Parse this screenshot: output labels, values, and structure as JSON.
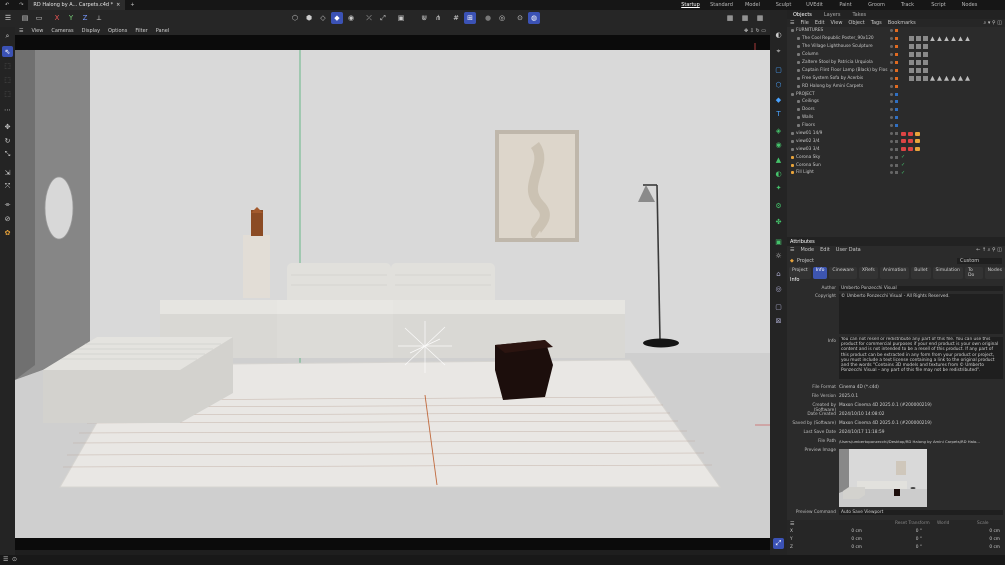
{
  "window": {
    "tab_title": "RD Halong by A... Carpets.c4d *",
    "layouts": [
      "Startup",
      "Standard",
      "Model",
      "Sculpt",
      "UVEdit",
      "Paint",
      "Groom",
      "Track",
      "Script",
      "Nodes"
    ],
    "active_layout": "Startup"
  },
  "viewport_menu": [
    "View",
    "Cameras",
    "Display",
    "Options",
    "Filter",
    "Panel"
  ],
  "object_manager": {
    "tabs": [
      "Objects",
      "Layers",
      "Takes"
    ],
    "active_tab": "Objects",
    "menu": [
      "File",
      "Edit",
      "View",
      "Object",
      "Tags",
      "Bookmarks"
    ],
    "items": [
      {
        "name": "FURNITURES",
        "color": "#e06a20"
      },
      {
        "name": "The Cool Republic Poster_90x120",
        "color": "#e06a20"
      },
      {
        "name": "The Village Lighthouse Sculpture",
        "color": "#e06a20"
      },
      {
        "name": "Column",
        "color": "#e06a20"
      },
      {
        "name": "Zaltere Stool by Patricia Urquiola",
        "color": "#e06a20"
      },
      {
        "name": "Captain Flint Floor Lamp (Black) by Flos",
        "color": "#e06a20"
      },
      {
        "name": "Free System Sofa by Acerbis",
        "color": "#e06a20"
      },
      {
        "name": "RD Halong by Amini Carpets",
        "color": "#e06a20"
      },
      {
        "name": "PROJECT",
        "color": "#2f6fc2"
      },
      {
        "name": "Ceilings",
        "color": "#2f6fc2"
      },
      {
        "name": "Doors",
        "color": "#2f6fc2"
      },
      {
        "name": "Walls",
        "color": "#2f6fc2"
      },
      {
        "name": "Floors",
        "color": "#2f6fc2"
      },
      {
        "name": "view01 14/9",
        "color": ""
      },
      {
        "name": "view02 3/4",
        "color": ""
      },
      {
        "name": "view03 3/4",
        "color": ""
      },
      {
        "name": "Corona Sky",
        "color": ""
      },
      {
        "name": "Corona Sun",
        "color": ""
      },
      {
        "name": "Fill Light",
        "color": ""
      }
    ]
  },
  "attributes": {
    "title": "Attributes",
    "menu": [
      "Mode",
      "Edit",
      "User Data"
    ],
    "object_label": "Project",
    "mode_value": "Custom",
    "tabs": [
      "Project",
      "Info",
      "Cineware",
      "XRefs",
      "Animation",
      "Bullet",
      "Simulation",
      "To Do",
      "Nodes"
    ],
    "active_tab": "Info",
    "section": "Info",
    "author_label": "Author",
    "author": "Umberto Ponzecchi Visual",
    "copyright_label": "Copyright",
    "copyright": "© Umberto Ponzecchi Visual - All Rights Reserved.",
    "info_label": "Info",
    "info_text": "You can not resell or redistribute any part of this file. You can use this product for commercial purposes if your end product is your own original content and is not intended to be a resell of this product. If any part of this product can be extracted in any form from your product or project, you must include a text license containing a link to the original product and the words \"Contains 3D models and textures from © Umberto Ponzecchi Visual – any part of this file may not be redistributed\".",
    "file_format_label": "File Format",
    "file_format": "Cinema 4D (*.c4d)",
    "file_version_label": "File Version",
    "file_version": "2025.0.1",
    "created_by_label": "Created by (Software)",
    "created_by": "Maxon Cinema 4D 2025.0.1 (#200000219)",
    "date_created_label": "Date Created",
    "date_created": "2024/10/10 14:08:02",
    "saved_by_label": "Saved by (Software)",
    "saved_by": "Maxon Cinema 4D 2025.0.1 (#200000219)",
    "last_save_label": "Last Save Date",
    "last_save": "2024/10/17 11:18:59",
    "file_path_label": "File Path",
    "file_path": "/Users/umbertoponzecchi/Desktop/RD Halong by Amini Carpets/RD Halo...",
    "preview_label": "Preview Image",
    "preview_command_label": "Preview Command",
    "preview_command": "Auto Save Viewport"
  },
  "coordinates": {
    "headers": [
      "Reset Transform",
      "World",
      "Scale"
    ],
    "rows": [
      {
        "axis": "X",
        "pos": "0 cm",
        "rot": "0 °",
        "scale": "0 cm"
      },
      {
        "axis": "Y",
        "pos": "0 cm",
        "rot": "0 °",
        "scale": "0 cm"
      },
      {
        "axis": "Z",
        "pos": "0 cm",
        "rot": "0 °",
        "scale": "0 cm"
      }
    ]
  }
}
